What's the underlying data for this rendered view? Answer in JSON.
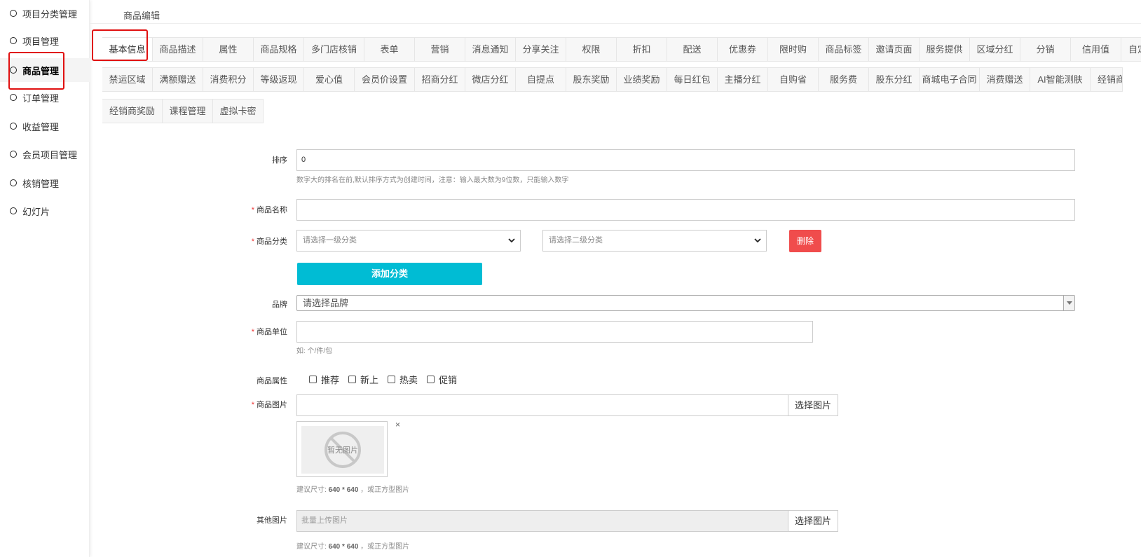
{
  "sidebar": {
    "items": [
      {
        "label": "项目分类管理",
        "active": false
      },
      {
        "label": "项目管理",
        "active": false
      },
      {
        "label": "商品管理",
        "active": true
      },
      {
        "label": "订单管理",
        "active": false
      },
      {
        "label": "收益管理",
        "active": false
      },
      {
        "label": "会员项目管理",
        "active": false
      },
      {
        "label": "核销管理",
        "active": false
      },
      {
        "label": "幻灯片",
        "active": false
      }
    ]
  },
  "header": {
    "title": "商品编辑"
  },
  "tabs": {
    "row1": [
      "基本信息",
      "商品描述",
      "属性",
      "商品规格",
      "多门店核销",
      "表单",
      "营销",
      "消息通知",
      "分享关注",
      "权限",
      "折扣",
      "配送",
      "优惠券",
      "限时购",
      "商品标签",
      "邀请页面",
      "服务提供",
      "区域分红",
      "分销",
      "信用值",
      "自定"
    ],
    "row2": [
      "禁运区域",
      "满额赠送",
      "消费积分",
      "等级返现",
      "爱心值",
      "会员价设置",
      "招商分红",
      "微店分红",
      "自提点",
      "股东奖励",
      "业绩奖励",
      "每日红包",
      "主播分红",
      "自购省",
      "服务费",
      "股东分红",
      "商城电子合同",
      "消费赠送",
      "AI智能测肤",
      "经销商奖"
    ],
    "row3": [
      "经销商奖励",
      "课程管理",
      "虚拟卡密"
    ]
  },
  "form": {
    "sort": {
      "label": "排序",
      "value": "0",
      "hint": "数字大的排名在前,默认排序方式为创建时间，注意：输入最大数为9位数，只能输入数字"
    },
    "name": {
      "label": "商品名称",
      "required_mark": "*",
      "value": ""
    },
    "category": {
      "label": "商品分类",
      "required_mark": "*",
      "primary_placeholder": "请选择一级分类",
      "secondary_placeholder": "请选择二级分类",
      "delete_label": "删除",
      "add_label": "添加分类"
    },
    "brand": {
      "label": "品牌",
      "placeholder": "请选择品牌"
    },
    "unit": {
      "label": "商品单位",
      "required_mark": "*",
      "value": "",
      "hint": "如: 个/件/包"
    },
    "attributes": {
      "label": "商品属性",
      "options": [
        "推荐",
        "新上",
        "热卖",
        "促销"
      ]
    },
    "image": {
      "label": "商品图片",
      "required_mark": "*",
      "value": "",
      "choose_label": "选择图片",
      "placeholder_text": "暂无图片",
      "remove_label": "×",
      "hint_prefix": "建议尺寸: ",
      "hint_size": "640 * 640",
      "hint_suffix": " ，或正方型图片"
    },
    "other_images": {
      "label": "其他图片",
      "placeholder": "批量上传图片",
      "choose_label": "选择图片",
      "hint_prefix": "建议尺寸: ",
      "hint_size": "640 * 640",
      "hint_suffix": " ，或正方型图片"
    }
  },
  "colors": {
    "accent": "#00bcd4",
    "danger": "#f04c4c",
    "highlight": "#e01010"
  }
}
